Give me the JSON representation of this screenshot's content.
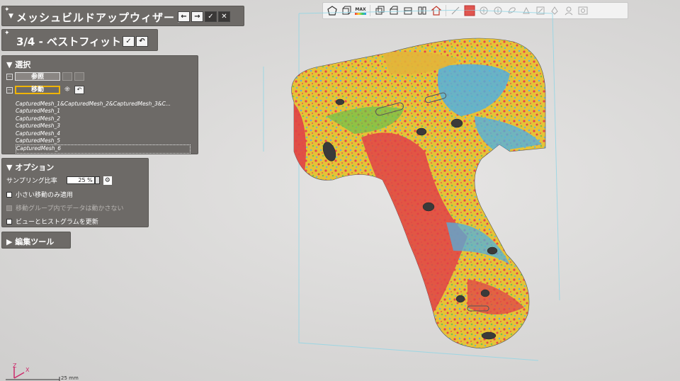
{
  "wizard": {
    "title": "メッシュビルドアップウィザード",
    "nav": [
      "←",
      "→",
      "✓",
      "✕"
    ]
  },
  "step": {
    "title": "3/4 - ベストフィット",
    "buttons": [
      "✓",
      "↶"
    ]
  },
  "selection": {
    "header": "▼ 選択",
    "reference_label": "参照",
    "move_label": "移動",
    "meshes": [
      "CapturedMesh_1&CapturedMesh_2&CapturedMesh_3&C...",
      "CapturedMesh_1",
      "CapturedMesh_2",
      "CapturedMesh_3",
      "CapturedMesh_4",
      "CapturedMesh_5",
      "CapturedMesh_6"
    ]
  },
  "options": {
    "header": "▼ オプション",
    "sampling_label": "サンプリング比率",
    "sampling_value": "25 %",
    "only_small_moves": "小さい移動のみ適用",
    "keep_in_group": "移動グループ内でデータは動かさない",
    "update_view": "ビューとヒストグラムを更新"
  },
  "tools": {
    "header": "▶ 編集ツール"
  },
  "toolbar": {
    "max_label": "MAX"
  },
  "axes": {
    "z": "Z",
    "x": "X",
    "scale": "25 mm"
  }
}
